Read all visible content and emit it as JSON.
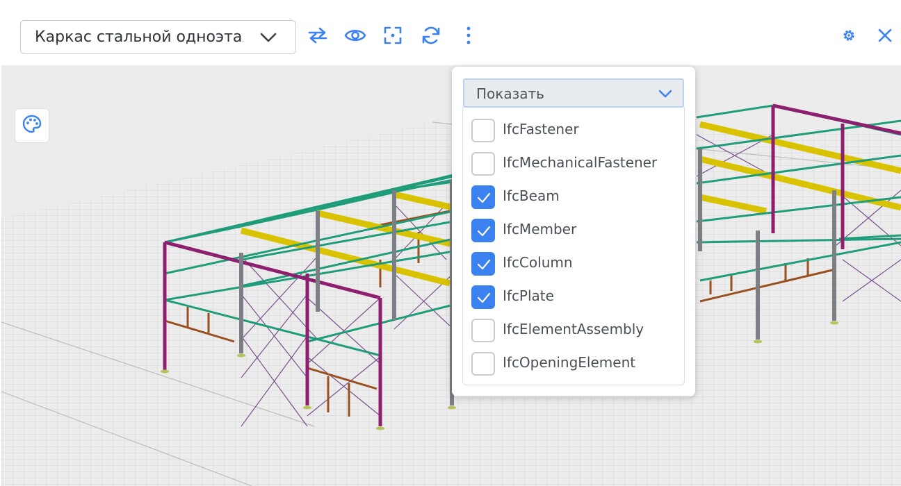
{
  "toolbar": {
    "model_select_value": "Каркас стальной одноэтажный",
    "icons": [
      "swap-icon",
      "eye-icon",
      "focus-frame-icon",
      "refresh-icon",
      "more-vertical-icon",
      "settings-icon",
      "close-icon"
    ]
  },
  "viewport": {
    "palette_icon": "palette-icon"
  },
  "filter_dropdown": {
    "select_label": "Показать",
    "items": [
      {
        "label": "IfcFastener",
        "checked": false
      },
      {
        "label": "IfcMechanicalFastener",
        "checked": false
      },
      {
        "label": "IfcBeam",
        "checked": true
      },
      {
        "label": "IfcMember",
        "checked": true
      },
      {
        "label": "IfcColumn",
        "checked": true
      },
      {
        "label": "IfcPlate",
        "checked": true
      },
      {
        "label": "IfcElementAssembly",
        "checked": false
      },
      {
        "label": "IfcOpeningElement",
        "checked": false
      }
    ]
  },
  "colors": {
    "accent": "#3b82f0",
    "column": "#8e1f6e",
    "beam_green": "#1f9c7a",
    "purlin_yellow": "#d9c200",
    "bracing": "#7a4f8c",
    "girt_brown": "#9a4f1f",
    "steel_grey": "#7d7f86"
  }
}
